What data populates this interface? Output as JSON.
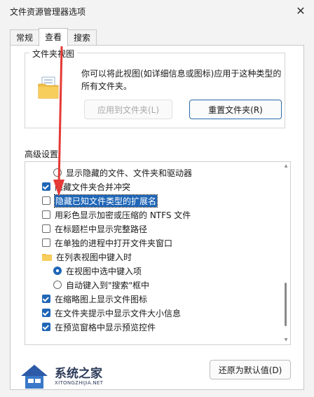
{
  "window": {
    "title": "文件资源管理器选项",
    "close_glyph": "✕"
  },
  "tabs": [
    {
      "label": "常规",
      "active": false
    },
    {
      "label": "查看",
      "active": true
    },
    {
      "label": "搜索",
      "active": false
    }
  ],
  "folder_views": {
    "legend": "文件夹视图",
    "icon": "folder-icon",
    "description": "你可以将此视图(如详细信息或图标)应用于这种类型的所有文件夹。",
    "apply_button": "应用到文件夹(L)",
    "reset_button": "重置文件夹(R)"
  },
  "advanced": {
    "label": "高级设置:",
    "items": [
      {
        "type": "radio",
        "indent": 2,
        "checked": false,
        "label": "显示隐藏的文件、文件夹和驱动器"
      },
      {
        "type": "checkbox",
        "indent": 1,
        "checked": true,
        "label": "隐藏文件夹合并冲突"
      },
      {
        "type": "checkbox",
        "indent": 1,
        "checked": false,
        "label": "隐藏已知文件类型的扩展名",
        "highlighted": true
      },
      {
        "type": "checkbox",
        "indent": 1,
        "checked": false,
        "label": "用彩色显示加密或压缩的 NTFS 文件"
      },
      {
        "type": "checkbox",
        "indent": 1,
        "checked": false,
        "label": "在标题栏中显示完整路径"
      },
      {
        "type": "checkbox",
        "indent": 1,
        "checked": false,
        "label": "在单独的进程中打开文件夹窗口"
      },
      {
        "type": "folder",
        "indent": 1,
        "label": "在列表视图中键入时"
      },
      {
        "type": "radio",
        "indent": 2,
        "checked": true,
        "label": "在视图中选中键入项"
      },
      {
        "type": "radio",
        "indent": 2,
        "checked": false,
        "label": "自动键入到\"搜索\"框中"
      },
      {
        "type": "checkbox",
        "indent": 1,
        "checked": true,
        "label": "在缩略图上显示文件图标"
      },
      {
        "type": "checkbox",
        "indent": 1,
        "checked": true,
        "label": "在文件夹提示中显示文件大小信息"
      },
      {
        "type": "checkbox",
        "indent": 1,
        "checked": true,
        "label": "在预览窗格中显示预览控件"
      }
    ],
    "restore_button": "还原为默认值(D)"
  },
  "watermark": {
    "name": "系统之家",
    "url": "XITONGZHIJIA.NET"
  },
  "colors": {
    "accent": "#1f66b7",
    "arrow": "#e53935"
  }
}
